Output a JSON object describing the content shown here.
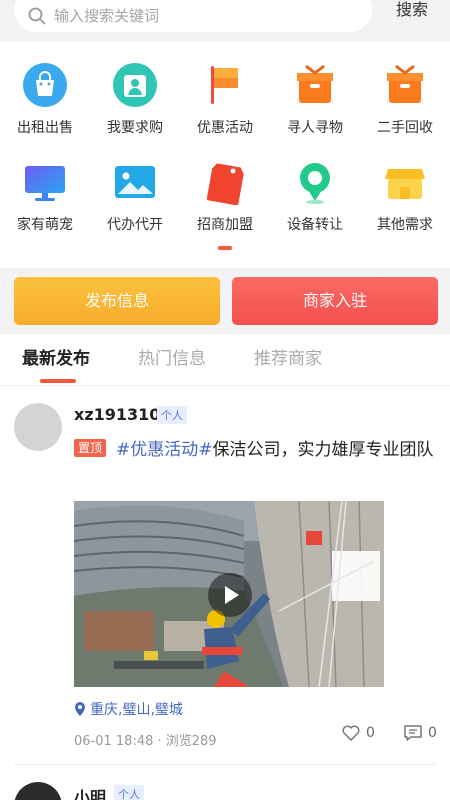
{
  "search": {
    "placeholder": "输入搜索关键词",
    "button_label": "搜索"
  },
  "categories": [
    {
      "label": "出租出售",
      "icon": "shopping-bag-icon",
      "color": "#3aa9f0"
    },
    {
      "label": "我要求购",
      "icon": "buyer-card-icon",
      "color": "#2fc6b6"
    },
    {
      "label": "优惠活动",
      "icon": "flag-icon",
      "color": "#ff5b4a"
    },
    {
      "label": "寻人寻物",
      "icon": "box-icon",
      "color": "#fb7a1e"
    },
    {
      "label": "二手回收",
      "icon": "box-icon",
      "color": "#fb7a1e"
    },
    {
      "label": "家有萌宠",
      "icon": "monitor-icon",
      "color": "#3c84f2"
    },
    {
      "label": "代办代开",
      "icon": "picture-icon",
      "color": "#22a8e8"
    },
    {
      "label": "招商加盟",
      "icon": "tag-icon",
      "color": "#f0442f"
    },
    {
      "label": "设备转让",
      "icon": "location-pin-icon",
      "color": "#22c98a"
    },
    {
      "label": "其他需求",
      "icon": "shop-icon",
      "color": "#fbbf25"
    }
  ],
  "actions": {
    "publish_label": "发布信息",
    "merchant_label": "商家入驻"
  },
  "tabs": [
    {
      "label": "最新发布",
      "active": true
    },
    {
      "label": "热门信息",
      "active": false
    },
    {
      "label": "推荐商家",
      "active": false
    }
  ],
  "posts": [
    {
      "username": "xz191310",
      "badge": "个人",
      "pin_label": "置顶",
      "hashtag": "#优惠活动#",
      "text": "保洁公司，实力雄厚专业团队",
      "location": "重庆,璧山,璧城",
      "meta": "06-01 18:48 · 浏览289",
      "likes": "0",
      "comments": "0"
    },
    {
      "username": "小明",
      "badge": "个人"
    }
  ],
  "colors": {
    "accent": "#f05a3c",
    "link": "#4668c5"
  }
}
